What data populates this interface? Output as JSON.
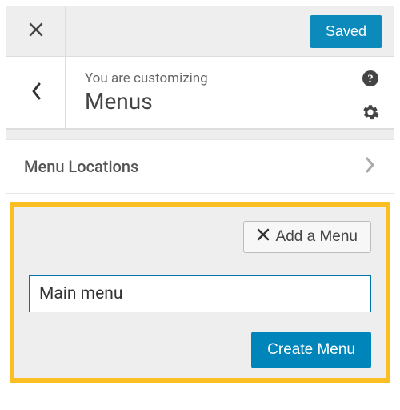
{
  "colors": {
    "accent": "#0085ba",
    "highlight_border": "#fbbf24",
    "panel_gray": "#eeeeee"
  },
  "top_bar": {
    "saved_label": "Saved"
  },
  "header": {
    "customizing_label": "You are customizing",
    "section_title": "Menus"
  },
  "sections": {
    "menu_locations_label": "Menu Locations"
  },
  "add_menu": {
    "button_label": "Add a Menu",
    "input_value": "Main menu",
    "create_label": "Create Menu"
  }
}
